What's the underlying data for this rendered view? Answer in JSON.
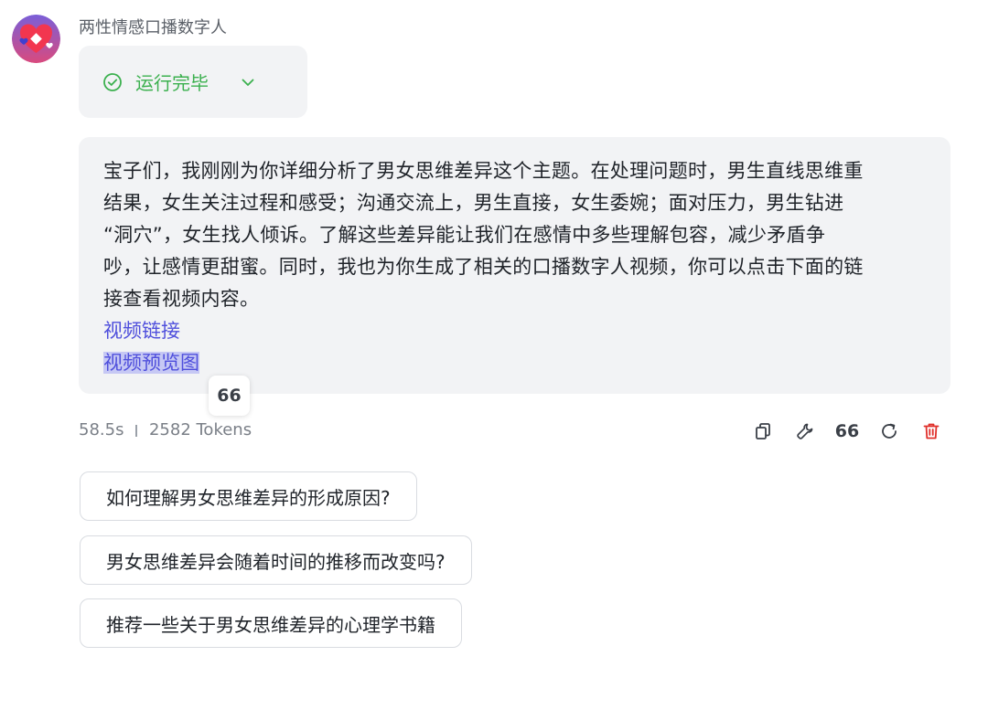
{
  "bot": {
    "name": "两性情感口播数字人",
    "avatar_icon": "heart-avatar-icon"
  },
  "status": {
    "text": "运行完毕",
    "color": "#3bb04e",
    "icon": "check-circle-icon",
    "expand_icon": "chevron-down-icon"
  },
  "message": {
    "lines": [
      "宝子们，我刚刚为你详细分析了男女思维差异这个主题。在处理问题时，男生直线思维重",
      "结果，女生关注过程和感受；沟通交流上，男生直接，女生委婉；面对压力，男生钻进",
      "“洞穴”，女生找人倾诉。了解这些差异能让我们在感情中多些理解包容，减少矛盾争",
      "吵，让感情更甜蜜。同时，我也为你生成了相关的口播数字人视频，你可以点击下面的链",
      "接查看视频内容。"
    ],
    "video_link": "视频链接",
    "preview_link": "视频预览图",
    "link_color": "#4f4fdc"
  },
  "quote_popup": {
    "label": "66"
  },
  "meta": {
    "time": "58.5s",
    "tokens": "2582 Tokens"
  },
  "actions": {
    "copy_icon": "copy-icon",
    "edit_icon": "wrench-icon",
    "quote_label": "66",
    "refresh_icon": "refresh-icon",
    "delete_icon": "trash-icon",
    "delete_color": "#e0302b"
  },
  "suggestions": [
    "如何理解男女思维差异的形成原因?",
    "男女思维差异会随着时间的推移而改变吗?",
    "推荐一些关于男女思维差异的心理学书籍"
  ]
}
